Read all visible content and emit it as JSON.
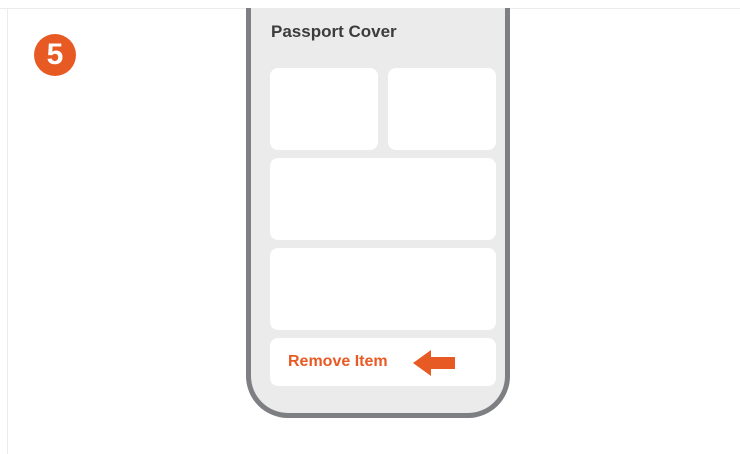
{
  "step": {
    "number": "5"
  },
  "screen": {
    "title": "Passport Cover",
    "remove_button_label": "Remove Item",
    "arrow_icon": "arrow-left-icon"
  },
  "colors": {
    "accent": "#e85a24",
    "phone_frame": "#7d7f82",
    "screen_bg": "#ebebeb",
    "card_bg": "#ffffff",
    "title_text": "#3c3c3c"
  }
}
